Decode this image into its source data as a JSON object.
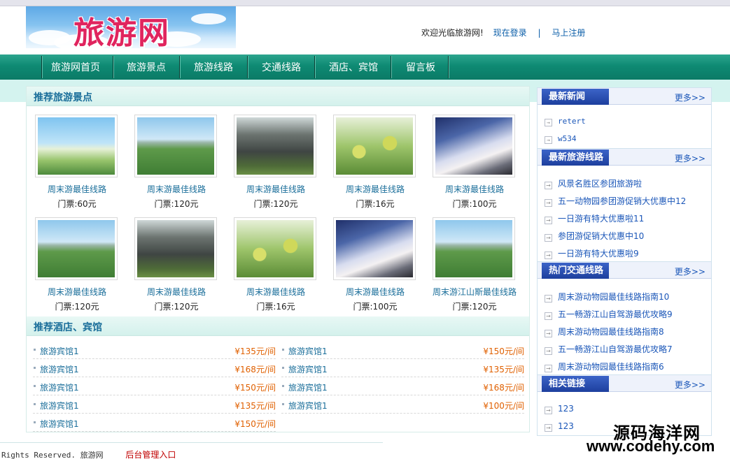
{
  "header": {
    "logo_text": "旅游网",
    "welcome": "欢迎光临旅游网!",
    "login": "现在登录",
    "separator": "|",
    "register": "马上注册"
  },
  "nav": {
    "items": [
      {
        "label": "旅游网首页"
      },
      {
        "label": "旅游景点"
      },
      {
        "label": "旅游线路"
      },
      {
        "label": "交通线路"
      },
      {
        "label": "酒店、宾馆"
      },
      {
        "label": "留言板"
      }
    ]
  },
  "spots": {
    "title": "推荐旅游景点",
    "items": [
      {
        "title": "周末游最佳线路",
        "price": "门票:60元",
        "img": "lake-pavilion"
      },
      {
        "title": "周末游最佳线路",
        "price": "门票:120元",
        "img": "lotus-field"
      },
      {
        "title": "周末游最佳线路",
        "price": "门票:120元",
        "img": "stone-gate"
      },
      {
        "title": "周末游最佳线路",
        "price": "门票:16元",
        "img": "fruit-branch"
      },
      {
        "title": "周末游最佳线路",
        "price": "门票:100元",
        "img": "sea-of-clouds"
      },
      {
        "title": "周末游最佳线路",
        "price": "门票:120元",
        "img": "lotus-field"
      },
      {
        "title": "周末游最佳线路",
        "price": "门票:120元",
        "img": "stone-gate"
      },
      {
        "title": "周末游最佳线路",
        "price": "门票:16元",
        "img": "fruit-branch"
      },
      {
        "title": "周末游最佳线路",
        "price": "门票:100元",
        "img": "sea-of-clouds"
      },
      {
        "title": "周末游江山斯最佳线路",
        "price": "门票:120元",
        "img": "lotus-field"
      }
    ]
  },
  "hotels": {
    "title": "推荐酒店、宾馆",
    "items": [
      {
        "name": "旅游宾馆1",
        "price": "¥135元/间"
      },
      {
        "name": "旅游宾馆1",
        "price": "¥150元/间"
      },
      {
        "name": "旅游宾馆1",
        "price": "¥168元/间"
      },
      {
        "name": "旅游宾馆1",
        "price": "¥135元/间"
      },
      {
        "name": "旅游宾馆1",
        "price": "¥150元/间"
      },
      {
        "name": "旅游宾馆1",
        "price": "¥168元/间"
      },
      {
        "name": "旅游宾馆1",
        "price": "¥135元/间"
      },
      {
        "name": "旅游宾馆1",
        "price": "¥100元/间"
      },
      {
        "name": "旅游宾馆1",
        "price": "¥150元/间"
      }
    ]
  },
  "sidebar": {
    "more_label": "更多>>",
    "news": {
      "title": "最新新闻",
      "items": [
        "retert",
        "w534"
      ]
    },
    "routes": {
      "title": "最新旅游线路",
      "items": [
        "风景名胜区参团旅游啦",
        "五一动物园参团游促销大优惠中12",
        "一日游有特大优惠啦11",
        "参团游促销大优惠中10",
        "一日游有特大优惠啦9"
      ]
    },
    "traffic": {
      "title": "热门交通线路",
      "items": [
        "周末游动物园最佳线路指南10",
        "五一畅游江山自驾游最优攻略9",
        "周末游动物园最佳线路指南8",
        "五一畅游江山自驾游最优攻略7",
        "周末游动物园最佳线路指南6"
      ]
    },
    "links": {
      "title": "相关链接",
      "items": [
        "123",
        "123"
      ]
    }
  },
  "footer": {
    "copyright": "Rights Reserved. 旅游网",
    "admin": "后台管理入口"
  },
  "watermark": {
    "line1": "源码海洋网",
    "line2": "www.codehy.com"
  }
}
